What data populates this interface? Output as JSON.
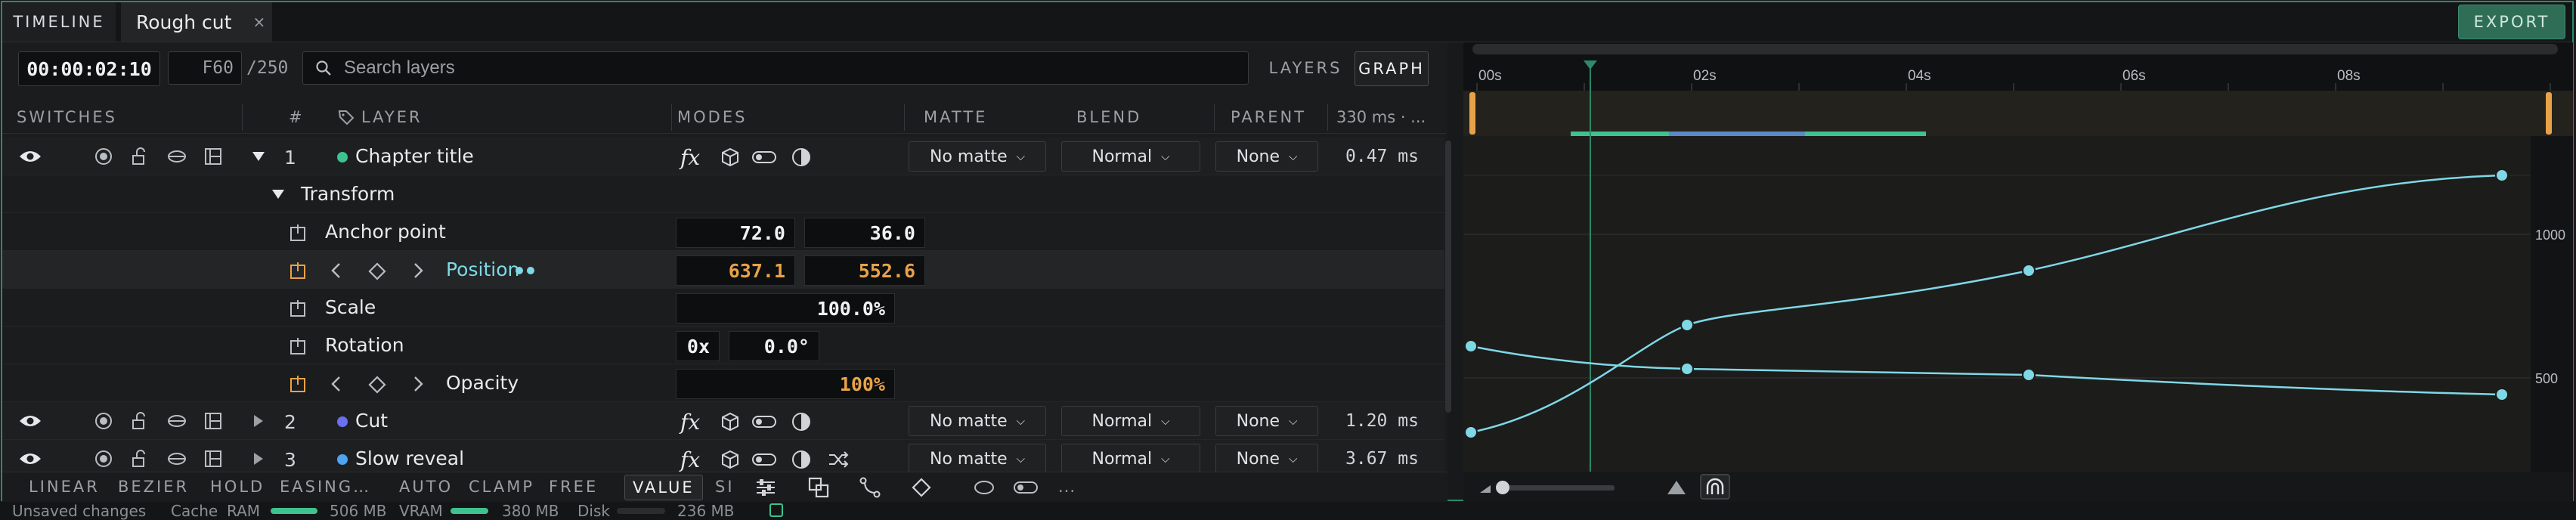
{
  "tabs": {
    "panel_label": "TIMELINE",
    "document_label": "Rough cut",
    "close_glyph": "×"
  },
  "export_label": "EXPORT",
  "toolbar": {
    "timecode": "00:00:02:10",
    "frame_value": "F60",
    "frame_total": "/250",
    "search_placeholder": "Search layers",
    "layers_label": "LAYERS",
    "graph_label": "GRAPH"
  },
  "columns": {
    "switches": "SWITCHES",
    "number": "#",
    "layer": "LAYER",
    "modes": "MODES",
    "matte": "MATTE",
    "blend": "BLEND",
    "parent": "PARENT",
    "duration": "330 ms · ..."
  },
  "layers": [
    {
      "index": "1",
      "name": "Chapter title",
      "color": "#3ec28e",
      "matte": "No matte",
      "blend": "Normal",
      "parent": "None",
      "duration": "0.47 ms",
      "expanded": true
    },
    {
      "index": "2",
      "name": "Cut",
      "color": "#6b6ff0",
      "matte": "No matte",
      "blend": "Normal",
      "parent": "None",
      "duration": "1.20 ms",
      "expanded": false
    },
    {
      "index": "3",
      "name": "Slow reveal",
      "color": "#4fa3f0",
      "matte": "No matte",
      "blend": "Normal",
      "parent": "None",
      "duration": "3.67 ms",
      "expanded": false
    }
  ],
  "transform": {
    "group_label": "Transform",
    "anchor": {
      "label": "Anchor point",
      "x": "72.0",
      "y": "36.0"
    },
    "position": {
      "label": "Position",
      "x": "637.1",
      "y": "552.6"
    },
    "scale": {
      "label": "Scale",
      "value": "100.0%"
    },
    "rotation": {
      "label": "Rotation",
      "turns": "0x",
      "degrees": "0.0°"
    },
    "opacity": {
      "label": "Opacity",
      "value": "100%"
    }
  },
  "modes_glyph": "fx",
  "bottom_toolbar": {
    "linear": "LINEAR",
    "bezier": "BEZIER",
    "hold": "HOLD",
    "easing": "EASING…",
    "auto": "AUTO",
    "clamp": "CLAMP",
    "free": "FREE",
    "value": "VALUE",
    "si": "SI",
    "more": "..."
  },
  "graph": {
    "ruler": [
      "00s",
      "02s",
      "04s",
      "06s",
      "08s"
    ],
    "value_labels": [
      "1000",
      "500"
    ],
    "playhead_seconds": 2.1,
    "visible_seconds": 10,
    "accent": "#7fd8e6"
  },
  "status": {
    "unsaved": "Unsaved changes",
    "cache": "Cache",
    "ram_label": "RAM",
    "ram_value": "506 MB",
    "vram_label": "VRAM",
    "vram_value": "380 MB",
    "disk_label": "Disk",
    "disk_value": "236 MB"
  }
}
